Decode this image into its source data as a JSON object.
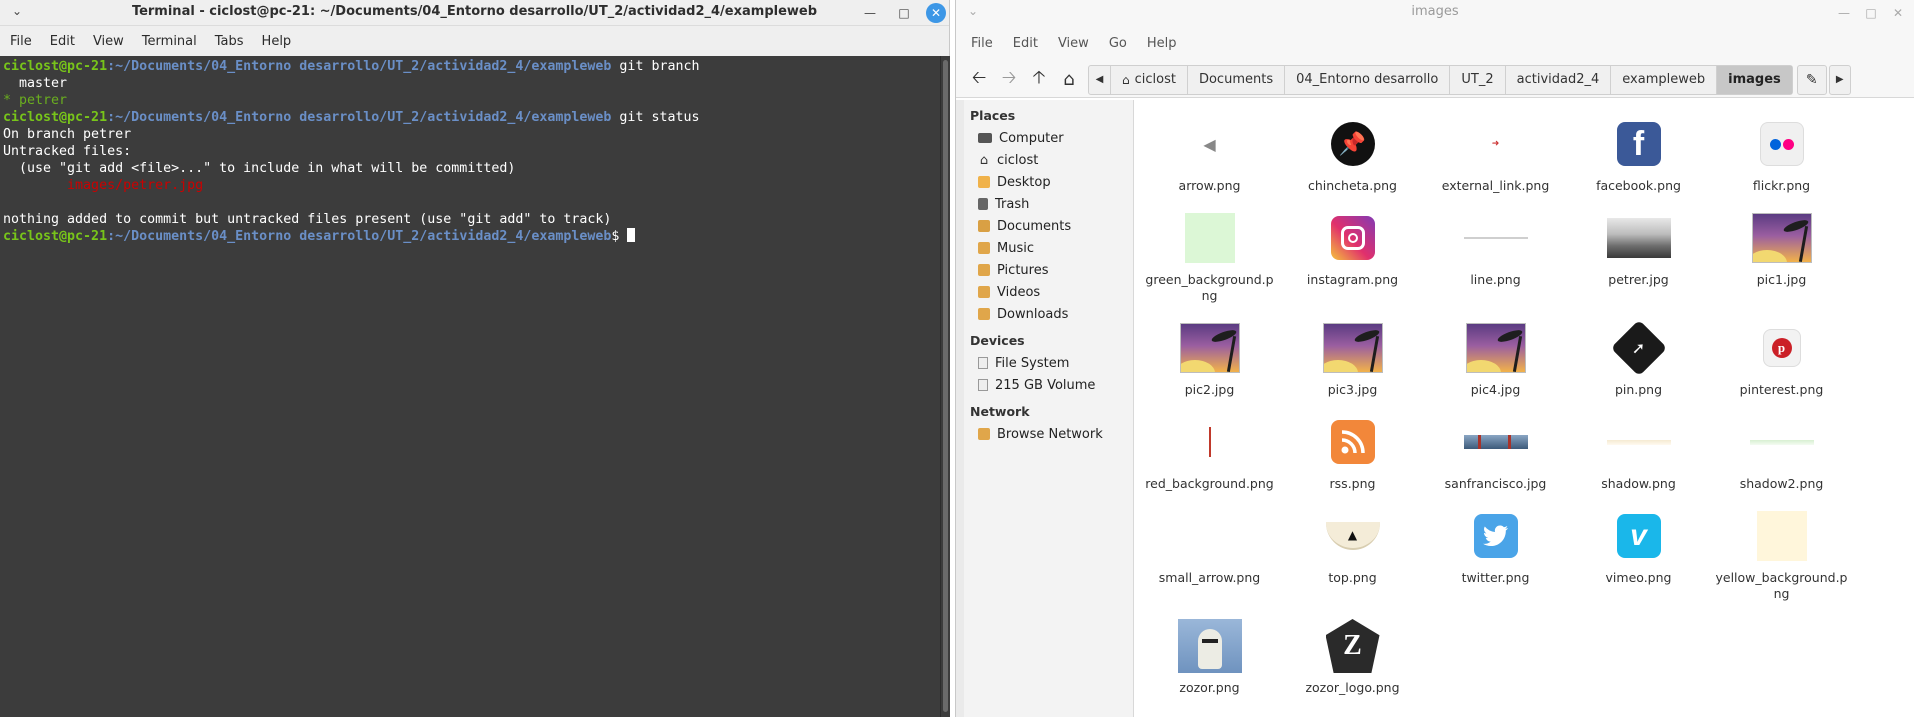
{
  "terminal": {
    "title": "Terminal - ciclost@pc-21: ~/Documents/04_Entorno desarrollo/UT_2/actividad2_4/exampleweb",
    "menu": [
      "File",
      "Edit",
      "View",
      "Terminal",
      "Tabs",
      "Help"
    ],
    "prompt_user": "ciclost@pc-21",
    "prompt_path": ":~/Documents/04_Entorno desarrollo/UT_2/actividad2_4/exampleweb",
    "cmd1": " git branch",
    "branch_master": "  master",
    "branch_current": "* petrer",
    "cmd2": " git status",
    "status_line1": "On branch petrer",
    "status_line2": "Untracked files:",
    "status_line3": "  (use \"git add <file>...\" to include in what will be committed)",
    "untracked_file": "        images/petrer.jpg",
    "status_line5": "nothing added to commit but untracked files present (use \"git add\" to track)"
  },
  "filemanager": {
    "title": "images",
    "menu": [
      "File",
      "Edit",
      "View",
      "Go",
      "Help"
    ],
    "breadcrumbs": [
      "ciclost",
      "Documents",
      "04_Entorno desarrollo",
      "UT_2",
      "actividad2_4",
      "exampleweb",
      "images"
    ],
    "sidebar": {
      "places_heading": "Places",
      "places": [
        "Computer",
        "ciclost",
        "Desktop",
        "Trash",
        "Documents",
        "Music",
        "Pictures",
        "Videos",
        "Downloads"
      ],
      "devices_heading": "Devices",
      "devices": [
        "File System",
        "215 GB Volume"
      ],
      "network_heading": "Network",
      "network": [
        "Browse Network"
      ]
    },
    "files": [
      {
        "name": "arrow.png",
        "icon": "arrow-thumb"
      },
      {
        "name": "chincheta.png",
        "icon": "pushpin-thumb"
      },
      {
        "name": "external_link.png",
        "icon": "external-link-thumb"
      },
      {
        "name": "facebook.png",
        "icon": "facebook-thumb"
      },
      {
        "name": "flickr.png",
        "icon": "flickr-thumb"
      },
      {
        "name": "green_background.png",
        "icon": "green-swatch-thumb"
      },
      {
        "name": "instagram.png",
        "icon": "instagram-thumb"
      },
      {
        "name": "line.png",
        "icon": "line-thumb"
      },
      {
        "name": "petrer.jpg",
        "icon": "photo-thumb"
      },
      {
        "name": "pic1.jpg",
        "icon": "sunset-thumb"
      },
      {
        "name": "pic2.jpg",
        "icon": "sunset-thumb"
      },
      {
        "name": "pic3.jpg",
        "icon": "sunset-thumb"
      },
      {
        "name": "pic4.jpg",
        "icon": "sunset-thumb"
      },
      {
        "name": "pin.png",
        "icon": "pin-thumb"
      },
      {
        "name": "pinterest.png",
        "icon": "pinterest-thumb"
      },
      {
        "name": "red_background.png",
        "icon": "red-line-thumb"
      },
      {
        "name": "rss.png",
        "icon": "rss-thumb"
      },
      {
        "name": "sanfrancisco.jpg",
        "icon": "bridge-thumb"
      },
      {
        "name": "shadow.png",
        "icon": "shadow-thumb"
      },
      {
        "name": "shadow2.png",
        "icon": "shadow2-thumb"
      },
      {
        "name": "small_arrow.png",
        "icon": "blank-thumb"
      },
      {
        "name": "top.png",
        "icon": "top-thumb"
      },
      {
        "name": "twitter.png",
        "icon": "twitter-thumb"
      },
      {
        "name": "vimeo.png",
        "icon": "vimeo-thumb"
      },
      {
        "name": "yellow_background.png",
        "icon": "yellow-swatch-thumb"
      },
      {
        "name": "zozor.png",
        "icon": "zozor-thumb"
      },
      {
        "name": "zozor_logo.png",
        "icon": "zozor-logo-thumb"
      }
    ]
  }
}
